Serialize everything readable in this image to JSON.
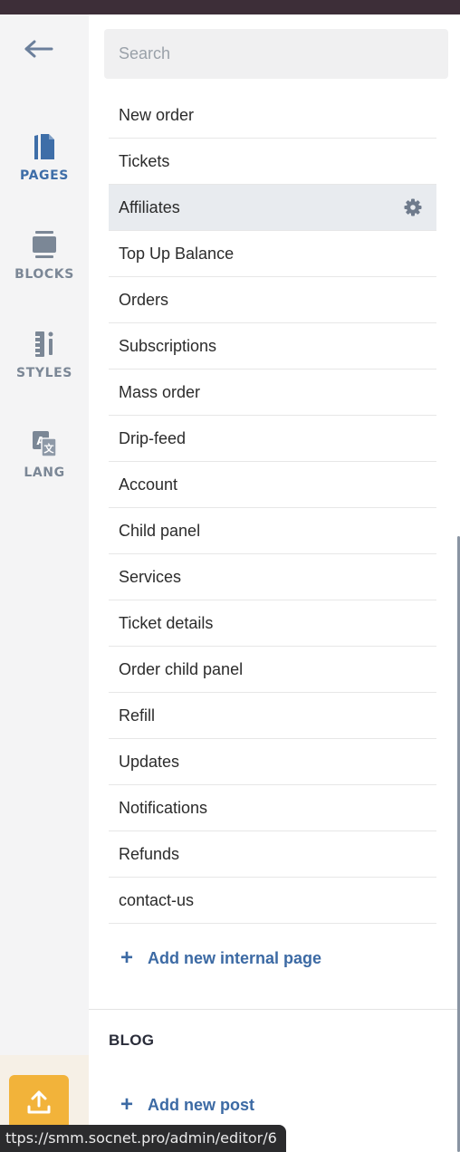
{
  "rail": {
    "items": [
      {
        "label": "PAGES",
        "icon": "pages-icon",
        "active": true
      },
      {
        "label": "BLOCKS",
        "icon": "blocks-icon",
        "active": false
      },
      {
        "label": "STYLES",
        "icon": "styles-icon",
        "active": false
      },
      {
        "label": "LANG",
        "icon": "lang-icon",
        "active": false
      }
    ]
  },
  "search": {
    "placeholder": "Search",
    "value": ""
  },
  "pages": [
    "New order",
    "Tickets",
    "Affiliates",
    "Top Up Balance",
    "Orders",
    "Subscriptions",
    "Mass order",
    "Drip-feed",
    "Account",
    "Child panel",
    "Services",
    "Ticket details",
    "Order child panel",
    "Refill",
    "Updates",
    "Notifications",
    "Refunds",
    "contact-us"
  ],
  "active_page": "Affiliates",
  "add_page_label": "Add new internal page",
  "blog": {
    "title": "BLOG",
    "add_post_label": "Add new post"
  },
  "status_url": "ttps://smm.socnet.pro/admin/editor/6",
  "colors": {
    "accent": "#3e6ea8",
    "upload_button": "#f2b33a",
    "active_row": "#e8ebef",
    "top_bar": "#3d2e38"
  }
}
